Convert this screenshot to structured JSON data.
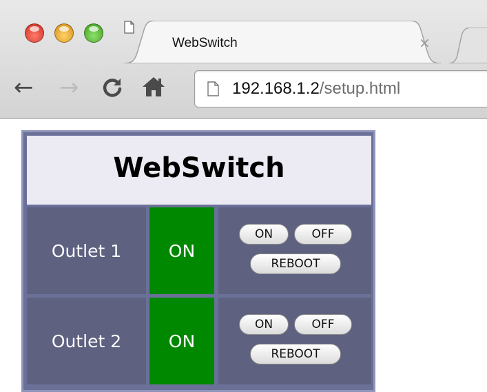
{
  "browser": {
    "tab_title": "WebSwitch",
    "tab_close": "×",
    "url_host": "192.168.1.2",
    "url_path": "/setup.html",
    "back_glyph": "←",
    "forward_glyph": "→"
  },
  "page": {
    "title": "WebSwitch",
    "outlets": [
      {
        "name": "Outlet 1",
        "state": "ON",
        "on_label": "ON",
        "off_label": "OFF",
        "reboot_label": "REBOOT"
      },
      {
        "name": "Outlet 2",
        "state": "ON",
        "on_label": "ON",
        "off_label": "OFF",
        "reboot_label": "REBOOT"
      }
    ]
  },
  "colors": {
    "panel_border": "#8f94ba",
    "row_background": "#5e6180",
    "status_on": "#008800",
    "header_background": "#eceaf2"
  },
  "icons": [
    "close-window-icon",
    "minimize-window-icon",
    "zoom-window-icon",
    "document-icon",
    "back-arrow-icon",
    "forward-arrow-icon",
    "reload-icon",
    "home-icon"
  ]
}
